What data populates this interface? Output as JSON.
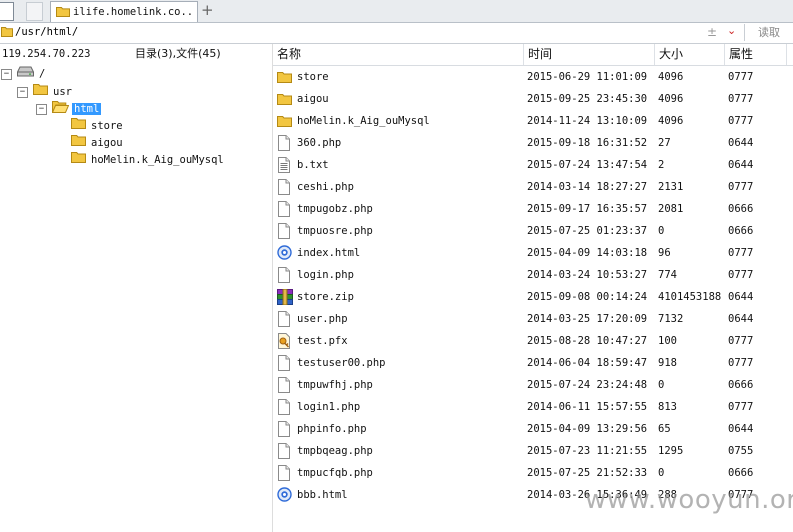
{
  "tabs": {
    "active_title": "ilife.homelink.co...",
    "add_label": "+"
  },
  "address": {
    "path": "/usr/html/",
    "go_label": "读取",
    "star": "±",
    "drop": "⌄"
  },
  "left": {
    "host_ip": "119.254.70.223",
    "count_label": "目录(3),文件(45)",
    "tree": [
      {
        "label": "/",
        "depth": 0,
        "toggle": "⊟",
        "icon": "drive-icon",
        "selected": false
      },
      {
        "label": "usr",
        "depth": 1,
        "toggle": "⊟",
        "icon": "folder-icon",
        "selected": false
      },
      {
        "label": "html",
        "depth": 2,
        "toggle": "⊟",
        "icon": "folder-open-icon",
        "selected": true
      },
      {
        "label": "store",
        "depth": 3,
        "toggle": "",
        "icon": "folder-icon",
        "selected": false
      },
      {
        "label": "aigou",
        "depth": 3,
        "toggle": "",
        "icon": "folder-icon",
        "selected": false
      },
      {
        "label": "hoMelin.k_Aig_ouMysql",
        "depth": 3,
        "toggle": "",
        "icon": "folder-icon",
        "selected": false
      }
    ]
  },
  "columns": {
    "name": "名称",
    "time": "时间",
    "size": "大小",
    "perm": "属性"
  },
  "files": [
    {
      "name": "store",
      "time": "2015-06-29 11:01:09",
      "size": "4096",
      "perm": "0777",
      "icon": "folder-icon"
    },
    {
      "name": "aigou",
      "time": "2015-09-25 23:45:30",
      "size": "4096",
      "perm": "0777",
      "icon": "folder-icon"
    },
    {
      "name": "hoMelin.k_Aig_ouMysql",
      "time": "2014-11-24 13:10:09",
      "size": "4096",
      "perm": "0777",
      "icon": "folder-icon"
    },
    {
      "name": "360.php",
      "time": "2015-09-18 16:31:52",
      "size": "27",
      "perm": "0644",
      "icon": "file-icon"
    },
    {
      "name": "b.txt",
      "time": "2015-07-24 13:47:54",
      "size": "2",
      "perm": "0644",
      "icon": "text-file-icon"
    },
    {
      "name": "ceshi.php",
      "time": "2014-03-14 18:27:27",
      "size": "2131",
      "perm": "0777",
      "icon": "file-icon"
    },
    {
      "name": "tmpugobz.php",
      "time": "2015-09-17 16:35:57",
      "size": "2081",
      "perm": "0666",
      "icon": "file-icon"
    },
    {
      "name": "tmpuosre.php",
      "time": "2015-07-25 01:23:37",
      "size": "0",
      "perm": "0666",
      "icon": "file-icon"
    },
    {
      "name": "index.html",
      "time": "2015-04-09 14:03:18",
      "size": "96",
      "perm": "0777",
      "icon": "html-file-icon"
    },
    {
      "name": "login.php",
      "time": "2014-03-24 10:53:27",
      "size": "774",
      "perm": "0777",
      "icon": "file-icon"
    },
    {
      "name": "store.zip",
      "time": "2015-09-08 00:14:24",
      "size": "4101453188",
      "perm": "0644",
      "icon": "zip-file-icon"
    },
    {
      "name": "user.php",
      "time": "2014-03-25 17:20:09",
      "size": "7132",
      "perm": "0644",
      "icon": "file-icon"
    },
    {
      "name": "test.pfx",
      "time": "2015-08-28 10:47:27",
      "size": "100",
      "perm": "0777",
      "icon": "certificate-file-icon"
    },
    {
      "name": "testuser00.php",
      "time": "2014-06-04 18:59:47",
      "size": "918",
      "perm": "0777",
      "icon": "file-icon"
    },
    {
      "name": "tmpuwfhj.php",
      "time": "2015-07-24 23:24:48",
      "size": "0",
      "perm": "0666",
      "icon": "file-icon"
    },
    {
      "name": "login1.php",
      "time": "2014-06-11 15:57:55",
      "size": "813",
      "perm": "0777",
      "icon": "file-icon"
    },
    {
      "name": "phpinfo.php",
      "time": "2015-04-09 13:29:56",
      "size": "65",
      "perm": "0644",
      "icon": "file-icon"
    },
    {
      "name": "tmpbqeag.php",
      "time": "2015-07-23 11:21:55",
      "size": "1295",
      "perm": "0755",
      "icon": "file-icon"
    },
    {
      "name": "tmpucfqb.php",
      "time": "2015-07-25 21:52:33",
      "size": "0",
      "perm": "0666",
      "icon": "file-icon"
    },
    {
      "name": "bbb.html",
      "time": "2014-03-26 15:36:49",
      "size": "288",
      "perm": "0777",
      "icon": "html-file-icon"
    }
  ],
  "watermark": "www.wooyun.org"
}
